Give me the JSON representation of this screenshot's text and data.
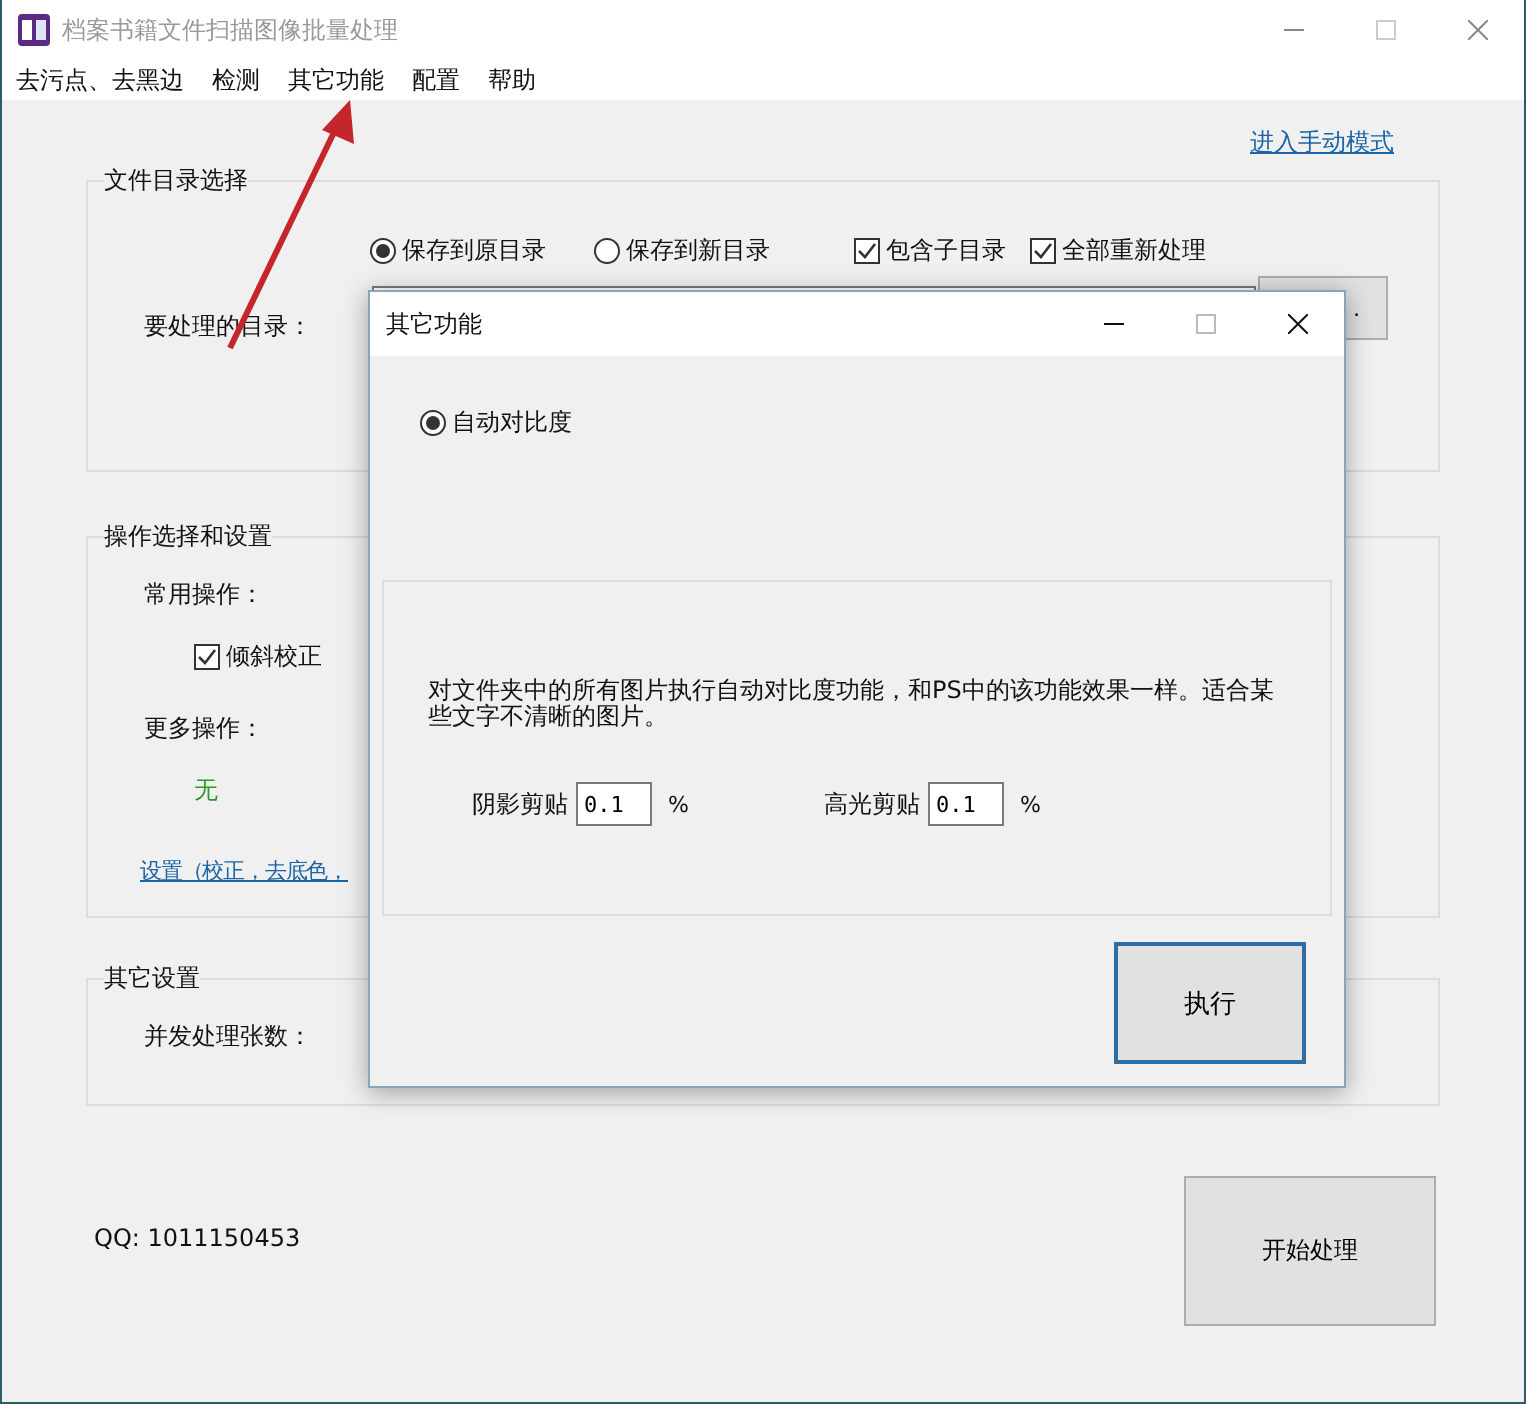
{
  "window": {
    "title": "档案书籍文件扫描图像批量处理"
  },
  "menu": [
    {
      "label": "去污点、去黑边"
    },
    {
      "label": "检测"
    },
    {
      "label": "其它功能"
    },
    {
      "label": "配置"
    },
    {
      "label": "帮助"
    }
  ],
  "manual_mode_link": "进入手动模式",
  "file_dir_group": {
    "title": "文件目录选择",
    "save_options": [
      {
        "label": "保存到原目录",
        "selected": true
      },
      {
        "label": "保存到新目录",
        "selected": false
      }
    ],
    "checkboxes": [
      {
        "label": "包含子目录",
        "checked": true
      },
      {
        "label": "全部重新处理",
        "checked": true
      }
    ],
    "dir_label": "要处理的目录：",
    "browse_button": "."
  },
  "ops_group": {
    "title": "操作选择和设置",
    "common_label": "常用操作：",
    "common_options": [
      {
        "label": "倾斜校正",
        "checked": true
      }
    ],
    "more_label": "更多操作：",
    "more_value": "无",
    "settings_link": "设置（校正，去底色，"
  },
  "other_group": {
    "title": "其它设置",
    "concurrency_label": "并发处理张数："
  },
  "qq": "QQ: 1011150453",
  "start_button": "开始处理",
  "dialog": {
    "title": "其它功能",
    "options": [
      {
        "label": "自动对比度",
        "selected": true
      }
    ],
    "description": "对文件夹中的所有图片执行自动对比度功能，和PS中的该功能效果一样。适合某些文字不清晰的图片。",
    "fields": [
      {
        "label": "阴影剪贴",
        "value": "0.1",
        "unit": "%"
      },
      {
        "label": "高光剪贴",
        "value": "0.1",
        "unit": "%"
      }
    ],
    "execute_button": "执行"
  }
}
